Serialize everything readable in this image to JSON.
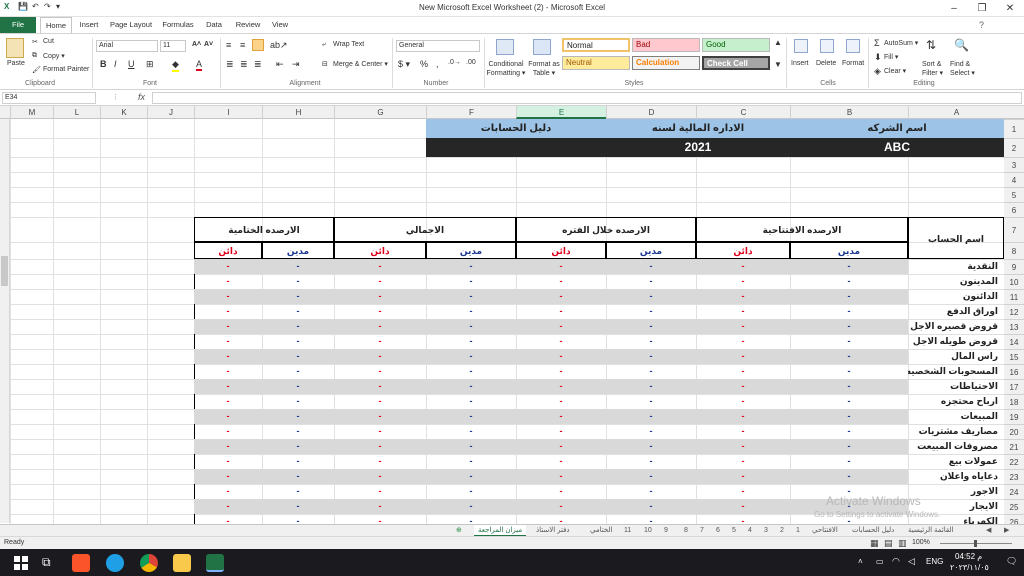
{
  "window": {
    "title": "New Microsoft Excel Worksheet (2)  -  Microsoft Excel",
    "qat": [
      "💾",
      "↶",
      "↷",
      "▾"
    ]
  },
  "tabs": [
    "File",
    "Home",
    "Insert",
    "Page Layout",
    "Formulas",
    "Data",
    "Review",
    "View"
  ],
  "ribbon": {
    "clipboard": {
      "paste": "Paste",
      "cut": "Cut",
      "copy": "Copy ▾",
      "format_painter": "Format Painter",
      "group": "Clipboard"
    },
    "font": {
      "name": "Arial",
      "size": "11",
      "group": "Font"
    },
    "alignment": {
      "wrap": "Wrap Text",
      "merge": "Merge & Center ▾",
      "group": "Alignment"
    },
    "number": {
      "format": "General",
      "group": "Number"
    },
    "styles": {
      "conditional": "Conditional Formatting ▾",
      "format_table": "Format as Table ▾",
      "normal": "Normal",
      "bad": "Bad",
      "good": "Good",
      "neutral": "Neutral",
      "calculation": "Calculation",
      "check_cell": "Check Cell",
      "group": "Styles"
    },
    "cells": {
      "insert": "Insert",
      "delete": "Delete",
      "format": "Format",
      "group": "Cells"
    },
    "editing": {
      "autosum": "AutoSum ▾",
      "fill": "Fill ▾",
      "clear": "Clear ▾",
      "sort": "Sort & Filter ▾",
      "find": "Find & Select ▾",
      "group": "Editing"
    }
  },
  "formula_bar": {
    "name_box": "E34",
    "fx": "fx",
    "value": ""
  },
  "columns": [
    "M",
    "L",
    "K",
    "J",
    "I",
    "H",
    "G",
    "F",
    "E",
    "D",
    "C",
    "B",
    "A"
  ],
  "rows": [
    "1",
    "2",
    "3",
    "4",
    "5",
    "6",
    "7",
    "8",
    "9",
    "10",
    "11",
    "12",
    "13",
    "14",
    "15",
    "16",
    "17",
    "18",
    "19",
    "20",
    "21",
    "22",
    "23",
    "24",
    "25",
    "26"
  ],
  "header": {
    "company_label": "اسم الشركه",
    "management_label": "الاداره المالية لسنه",
    "guide_label": "دليل الحسابات",
    "company_value": "ABC",
    "year_value": "2021"
  },
  "table": {
    "account_name_header": "اسم الحساب",
    "groups": [
      "الارصده الافتتاحية",
      "الارصده خلال الفتره",
      "الاجمالي",
      "الارصده الختامية"
    ],
    "debit": "مدين",
    "credit": "دائن",
    "dash": "-",
    "accounts": [
      "النقدية",
      "المدينون",
      "الدائنون",
      "اوراق الدفع",
      "قروض قصيره الاجل",
      "قروض طويله الاجل",
      "راس المال",
      "المسحوبات الشخصيه",
      "الاحتياطات",
      "ارباح محتجزه",
      "المبيعات",
      "مصاريف مشتريات",
      "مصروفات المبيعت",
      "عمولات بيع",
      "دعاياه واعلان",
      "الاجور",
      "الايجار",
      "الكهرباء"
    ]
  },
  "watermark": {
    "line1": "Activate Windows",
    "line2": "Go to Settings to activate Windows."
  },
  "sheet_tabs": [
    "ميزان المراجعة",
    "دفتر الاستاذ",
    "الختامي",
    "11",
    "10",
    "9",
    "8",
    "7",
    "6",
    "5",
    "4",
    "3",
    "2",
    "1",
    "الافتتاحي",
    "دليل الحسابات",
    "القائمة الرئيسية"
  ],
  "status": {
    "ready": "Ready",
    "zoom": "100%"
  },
  "taskbar": {
    "time": "04:52 م",
    "date": "٢٠٢٣/١١/٠٥",
    "lang": "ENG"
  },
  "colors": {
    "excel_green": "#217346",
    "blue_header": "#9dc3e6",
    "black_bar": "#262626",
    "gray_stripe": "#d9d9d9",
    "debit_color": "#1f3a93",
    "credit_color": "#e0001b"
  }
}
